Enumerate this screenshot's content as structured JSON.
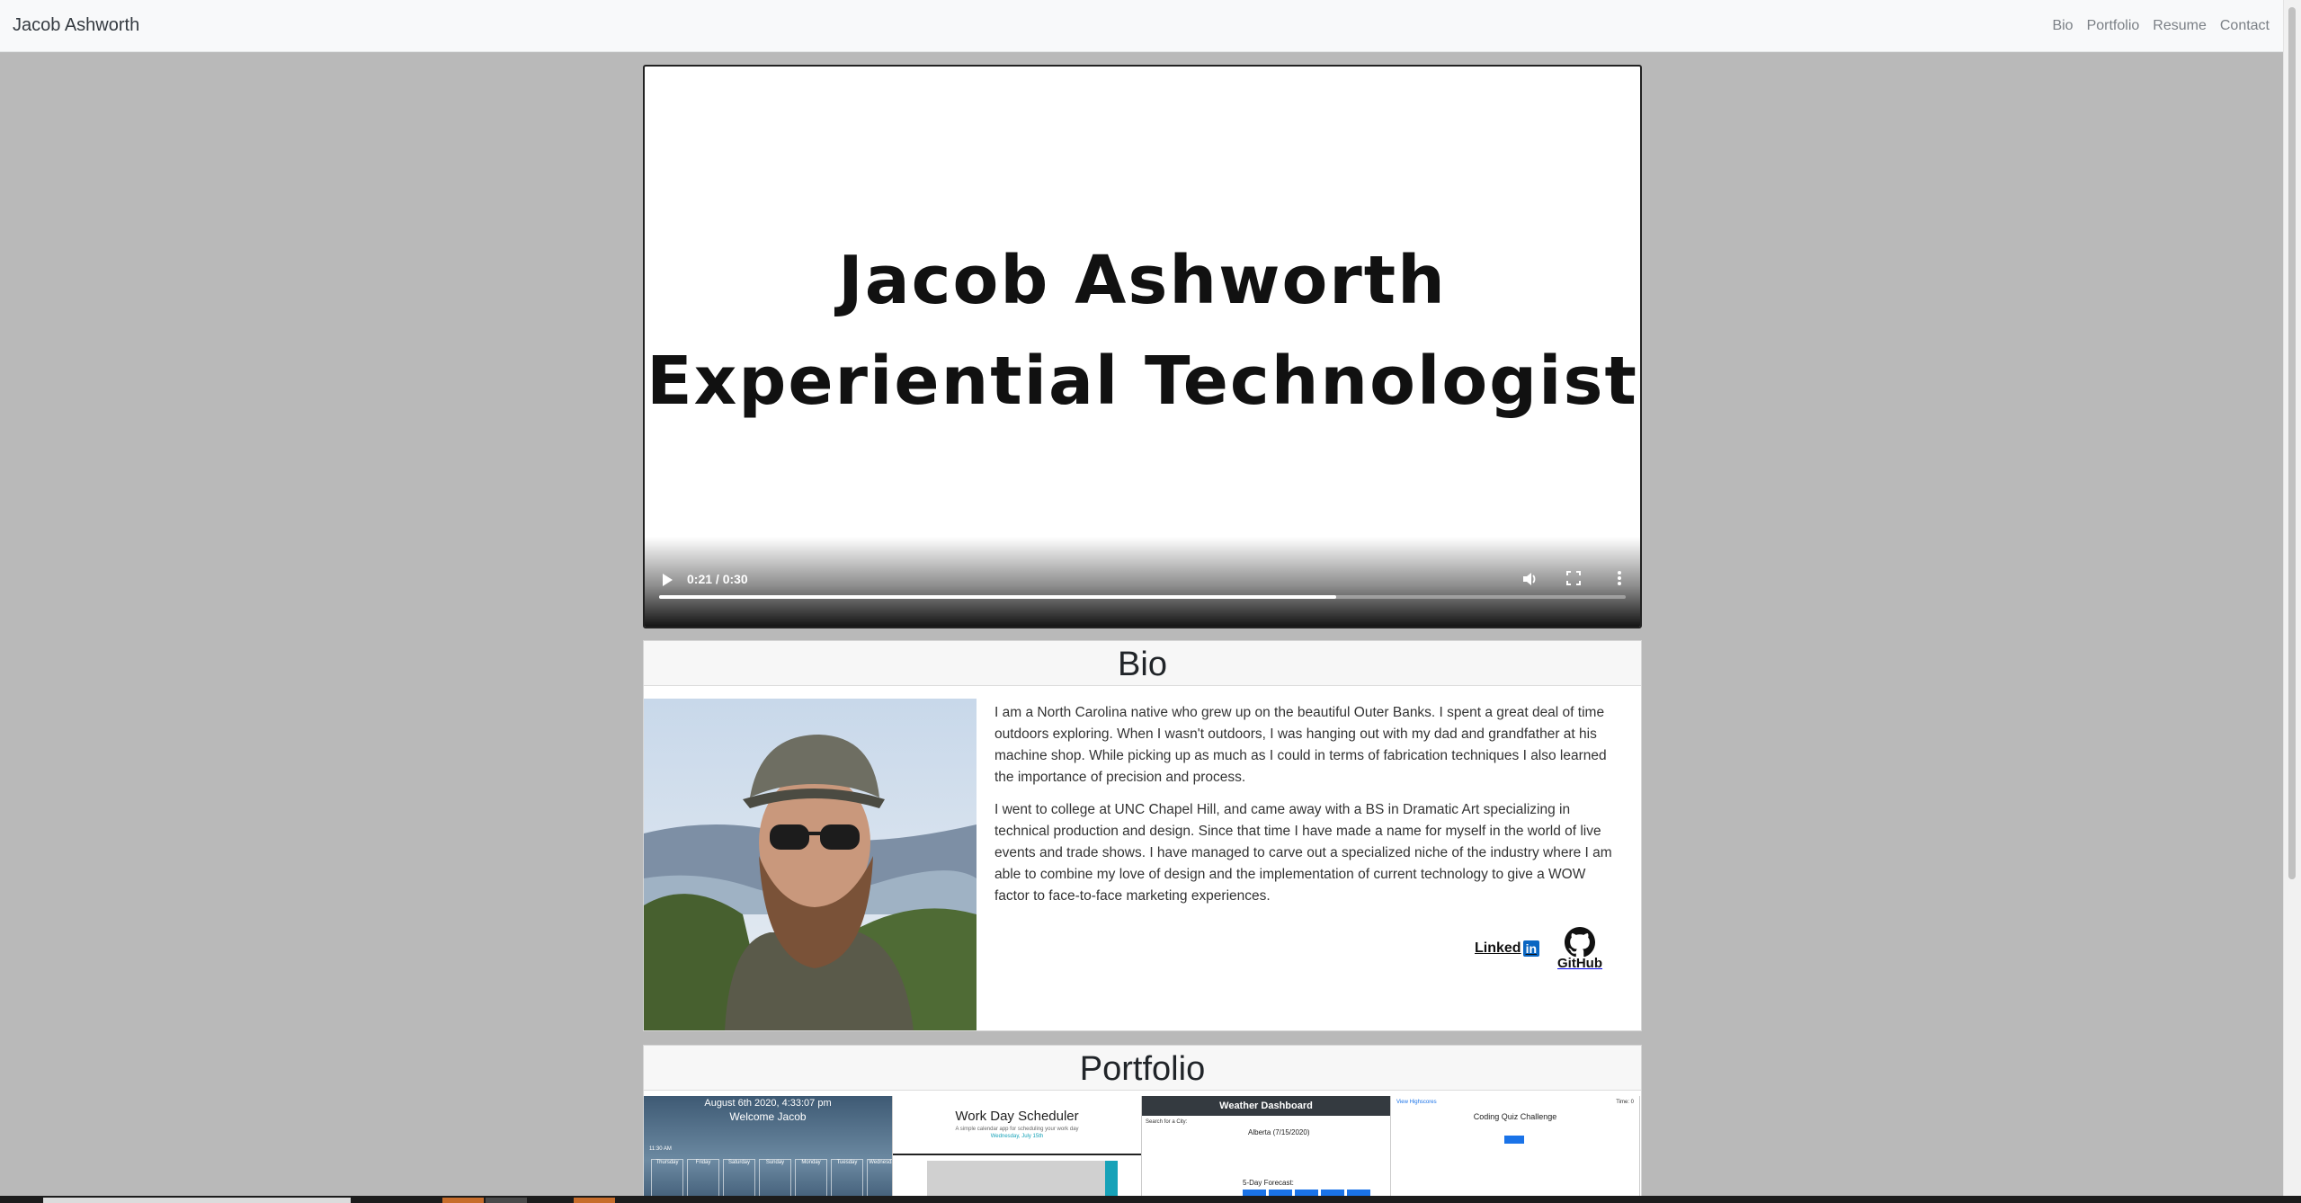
{
  "navbar": {
    "brand": "Jacob Ashworth",
    "links": [
      "Bio",
      "Portfolio",
      "Resume",
      "Contact"
    ]
  },
  "video": {
    "title_line1": "Jacob Ashworth",
    "title_line2": "Experiential Technologist",
    "time": "0:21 / 0:30",
    "progress_fraction": 0.7
  },
  "bio": {
    "heading": "Bio",
    "paragraphs": [
      "I am a North Carolina native who grew up on the beautiful Outer Banks. I spent a great deal of time outdoors exploring. When I wasn't outdoors, I was hanging out with my dad and grandfather at his machine shop. While picking up as much as I could in terms of fabrication techniques I also learned the importance of precision and process.",
      "I went to college at UNC Chapel Hill, and came away with a BS in Dramatic Art specializing in technical production and design. Since that time I have made a name for myself in the world of live events and trade shows. I have managed to carve out a specialized niche of the industry where I am able to combine my love of design and the implementation of current technology to give a WOW factor to face-to-face marketing experiences."
    ],
    "linkedin_text": "Linked",
    "linkedin_in": "in",
    "github_label": "GitHub"
  },
  "portfolio": {
    "heading": "Portfolio",
    "thumbs": {
      "dashboard": {
        "date": "August 6th 2020, 4:33:07 pm",
        "welcome": "Welcome Jacob",
        "tag": "11:30 AM",
        "days": [
          "Thursday",
          "Friday",
          "Saturday",
          "Sunday",
          "Monday",
          "Tuesday",
          "Wednesday"
        ]
      },
      "scheduler": {
        "title": "Work Day Scheduler",
        "subtitle": "A simple calendar app for scheduling your work day",
        "date": "Wednesday, July 15th"
      },
      "weather": {
        "title": "Weather Dashboard",
        "search_label": "Search for a City:",
        "city": "Alberta (7/15/2020)",
        "forecast": "5-Day Forecast:"
      },
      "quiz": {
        "highscores": "View Highscores",
        "time": "Time: 0",
        "title": "Coding Quiz Challenge"
      }
    }
  },
  "colors": {
    "page_background": "#b9b9b9",
    "navbar_background": "#f8f9fa",
    "linkedin_blue": "#0a66c2"
  }
}
